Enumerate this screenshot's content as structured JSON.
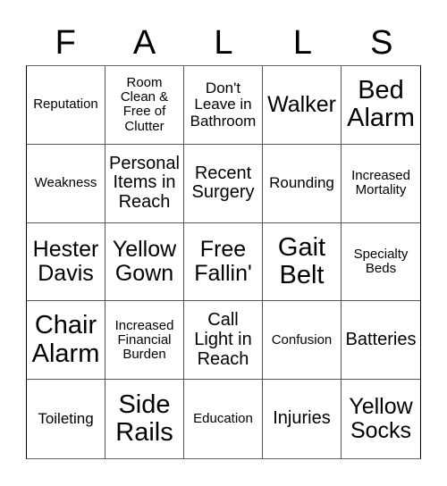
{
  "header": {
    "letters": [
      "F",
      "A",
      "L",
      "L",
      "S"
    ]
  },
  "board": {
    "cells": [
      [
        "Reputation",
        "Room Clean & Free of Clutter",
        "Don't Leave in Bathroom",
        "Walker",
        "Bed Alarm"
      ],
      [
        "Weakness",
        "Personal Items in Reach",
        "Recent Surgery",
        "Rounding",
        "Increased Mortality"
      ],
      [
        "Hester Davis",
        "Yellow Gown",
        "Free Fallin'",
        "Gait Belt",
        "Specialty Beds"
      ],
      [
        "Chair Alarm",
        "Increased Financial Burden",
        "Call Light in Reach",
        "Confusion",
        "Batteries"
      ],
      [
        "Toileting",
        "Side Rails",
        "Education",
        "Injuries",
        "Yellow Socks"
      ]
    ]
  }
}
